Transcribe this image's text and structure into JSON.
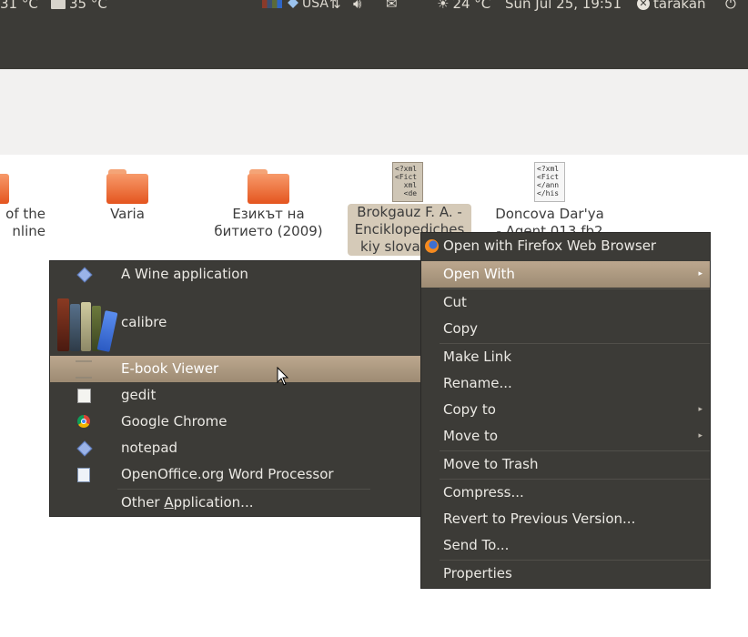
{
  "topbar": {
    "temp_left1": "31 °C",
    "temp_left2": "35 °C",
    "keyboard": "USA",
    "weather": "24 °C",
    "clock": "Sun Jul 25, 19:51",
    "user": "tarakan"
  },
  "files": [
    {
      "label1": "of the",
      "label2": "nline"
    },
    {
      "label1": "Varia",
      "label2": ""
    },
    {
      "label1": "Езикът на",
      "label2": "битието (2009)"
    },
    {
      "label1": "Brokgauz F. A. -",
      "label2": "Enciklopediches",
      "label3": "kiy slova",
      "icon_text": "<?xml\n<Fict\n  xml\n  <de"
    },
    {
      "label1": "Doncova Dar'ya",
      "label2": "- Agent 013.fb2",
      "icon_text": "<?xml\n<Fict\n</ann\n</his"
    }
  ],
  "context_menu": {
    "items": [
      {
        "label": "Open with Firefox Web Browser",
        "icon": "firefox-icon"
      },
      {
        "label": "Open With",
        "submenu": true
      },
      {
        "label": "Cut"
      },
      {
        "label": "Copy"
      },
      {
        "label": "Make Link"
      },
      {
        "label": "Rename..."
      },
      {
        "label": "Copy to",
        "submenu": true
      },
      {
        "label": "Move to",
        "submenu": true
      },
      {
        "label": "Move to Trash"
      },
      {
        "label": "Compress..."
      },
      {
        "label": "Revert to Previous Version..."
      },
      {
        "label": "Send To..."
      },
      {
        "label": "Properties"
      }
    ],
    "arrow": "▸"
  },
  "open_with_menu": {
    "items": [
      {
        "label": "A Wine application",
        "icon": "wine-icon"
      },
      {
        "label": "calibre",
        "icon": "calibre-icon"
      },
      {
        "label": "E-book Viewer",
        "icon": "ebook-viewer-icon"
      },
      {
        "label": "gedit",
        "icon": "gedit-icon"
      },
      {
        "label": "Google Chrome",
        "icon": "chrome-icon"
      },
      {
        "label": "notepad",
        "icon": "wine-icon"
      },
      {
        "label": "OpenOffice.org Word Processor",
        "icon": "writer-icon"
      }
    ],
    "other_pre": "Other ",
    "other_ul": "A",
    "other_post": "pplication..."
  },
  "colors": {
    "panel": "#3c3b37",
    "highlight": "#bca78e",
    "folder": "#e4551f"
  }
}
